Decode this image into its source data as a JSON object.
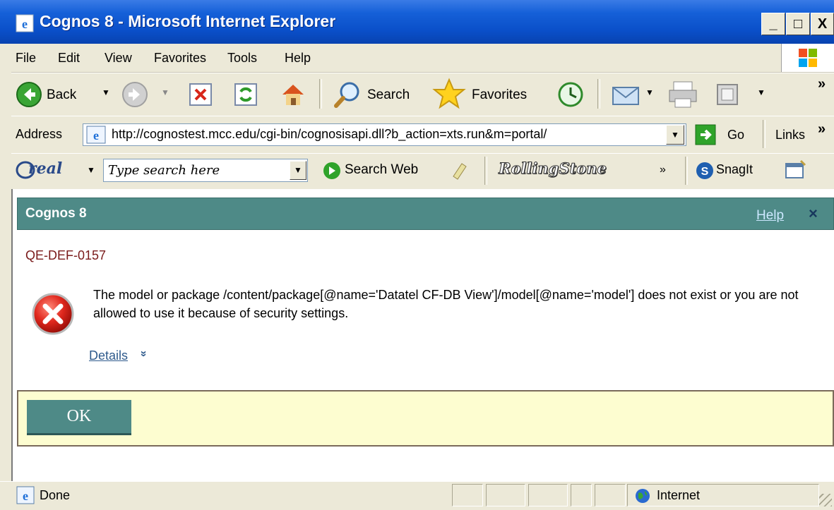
{
  "window": {
    "title": "Cognos 8 - Microsoft Internet Explorer",
    "min_label": "_",
    "max_label": "□",
    "close_label": "X"
  },
  "menu": {
    "items": [
      {
        "label": "File"
      },
      {
        "label": "Edit"
      },
      {
        "label": "View"
      },
      {
        "label": "Favorites"
      },
      {
        "label": "Tools"
      },
      {
        "label": "Help"
      }
    ]
  },
  "toolbar": {
    "back_label": "Back",
    "search_label": "Search",
    "favorites_label": "Favorites",
    "more_label": "»"
  },
  "address": {
    "label": "Address",
    "url": "http://cognostest.mcc.edu/cgi-bin/cognosisapi.dll?b_action=xts.run&m=portal/",
    "go_label": "Go",
    "links_label": "Links",
    "more_label": "»"
  },
  "links_bar": {
    "real_label": "real",
    "search_placeholder": "Type search here",
    "search_web_label": "Search Web",
    "rollingstone_label": "RollingStone",
    "more_label": "»",
    "snagit_label": "SnagIt"
  },
  "dialog": {
    "title": "Cognos 8",
    "help_label": "Help",
    "close_label": "×",
    "error_code": "QE-DEF-0157",
    "error_message": "The model or package /content/package[@name='Datatel CF-DB View']/model[@name='model'] does not exist or you are not allowed to use it because of security settings.",
    "details_label": "Details",
    "details_chevron": "»",
    "ok_label": "OK"
  },
  "status": {
    "text": "Done",
    "zone": "Internet"
  },
  "colors": {
    "titlebar": "#0a4fc9",
    "dialog_header": "#4e8a87",
    "ok_bar": "#fdfdd0",
    "error_code": "#7a1b1b"
  }
}
